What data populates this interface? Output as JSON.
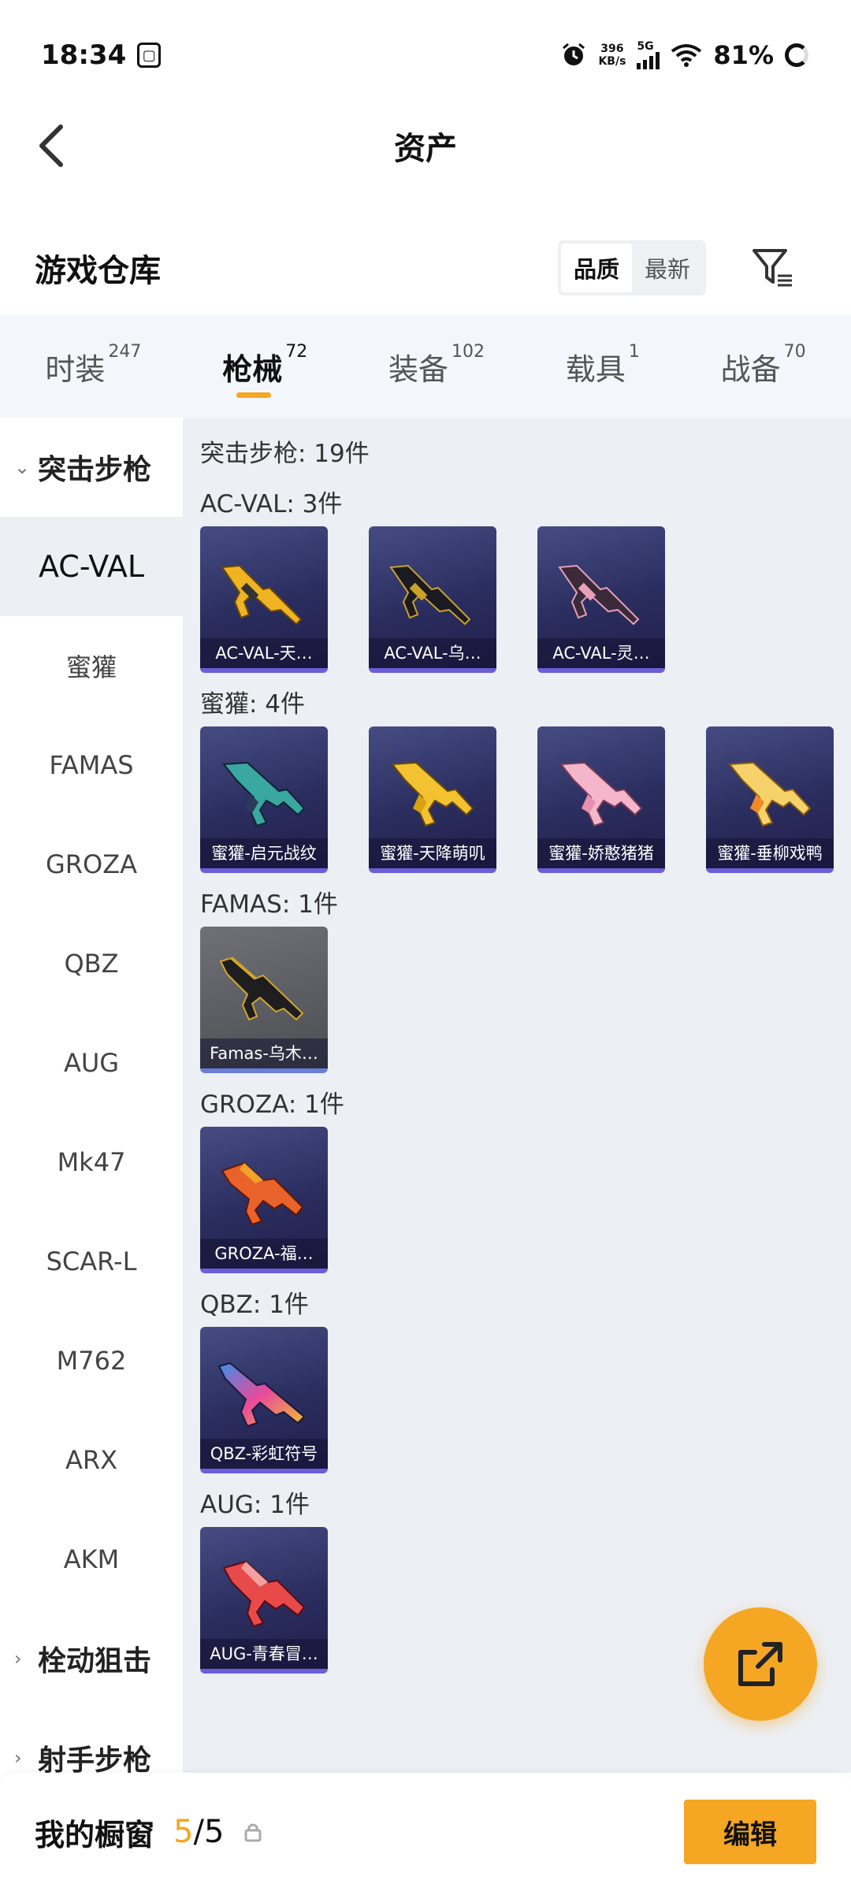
{
  "status_bar": {
    "time": "18:34",
    "sim_icon": "sim-card-icon",
    "net_speed_value": "396",
    "net_speed_unit": "KB/s",
    "network_type": "5G",
    "battery": "81%"
  },
  "header": {
    "title": "资产",
    "back_icon": "back-chevron-icon"
  },
  "warehouse": {
    "title": "游戏仓库",
    "sort_options": [
      "品质",
      "最新"
    ],
    "active_sort": "品质",
    "filter_icon": "filter-icon"
  },
  "tabs": [
    {
      "label": "时装",
      "count": "247"
    },
    {
      "label": "枪械",
      "count": "72",
      "active": true
    },
    {
      "label": "装备",
      "count": "102"
    },
    {
      "label": "载具",
      "count": "1"
    },
    {
      "label": "战备",
      "count": "70"
    }
  ],
  "sidebar": {
    "groups": [
      {
        "label": "突击步枪",
        "expanded": true
      },
      {
        "label": "栓动狙击",
        "expanded": false
      },
      {
        "label": "射手步枪",
        "expanded": false
      }
    ],
    "items": [
      "AC-VAL",
      "蜜獾",
      "FAMAS",
      "GROZA",
      "QBZ",
      "AUG",
      "Mk47",
      "SCAR-L",
      "M762",
      "ARX",
      "AKM"
    ],
    "active_item": "AC-VAL"
  },
  "content": {
    "total_label": "突击步枪: 19件",
    "sections": [
      {
        "label": "AC-VAL: 3件",
        "items": [
          "AC-VAL-天…",
          "AC-VAL-乌…",
          "AC-VAL-灵…"
        ]
      },
      {
        "label": "蜜獾: 4件",
        "items": [
          "蜜獾-启元战纹",
          "蜜獾-天降萌叽",
          "蜜獾-娇憨猪猪",
          "蜜獾-垂柳戏鸭"
        ]
      },
      {
        "label": "FAMAS: 1件",
        "items": [
          "Famas-乌木…"
        ]
      },
      {
        "label": "GROZA: 1件",
        "items": [
          "GROZA-福…"
        ]
      },
      {
        "label": "QBZ: 1件",
        "items": [
          "QBZ-彩虹符号"
        ]
      },
      {
        "label": "AUG: 1件",
        "items": [
          "AUG-青春冒…"
        ]
      }
    ]
  },
  "fab": {
    "icon": "share-export-icon"
  },
  "bottom_bar": {
    "title": "我的橱窗",
    "current": "5",
    "slash": "/",
    "max": "5",
    "lock_icon": "lock-icon",
    "edit_label": "编辑"
  },
  "colors": {
    "accent": "#f5a623",
    "card_bg": "#2a2d5e",
    "content_bg": "#eceff4"
  }
}
